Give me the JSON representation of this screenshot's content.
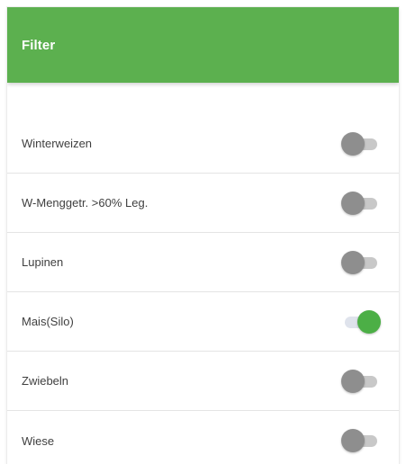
{
  "header": {
    "title": "Filter"
  },
  "filters": [
    {
      "label": "Winterweizen",
      "enabled": false
    },
    {
      "label": "W-Menggetr. >60% Leg.",
      "enabled": false
    },
    {
      "label": "Lupinen",
      "enabled": false
    },
    {
      "label": "Mais(Silo)",
      "enabled": true
    },
    {
      "label": "Zwiebeln",
      "enabled": false
    },
    {
      "label": "Wiese",
      "enabled": false
    }
  ],
  "colors": {
    "app_bar": "#5cb04f",
    "switch_on": "#4caf46",
    "switch_off_thumb": "#8e8e8e"
  }
}
